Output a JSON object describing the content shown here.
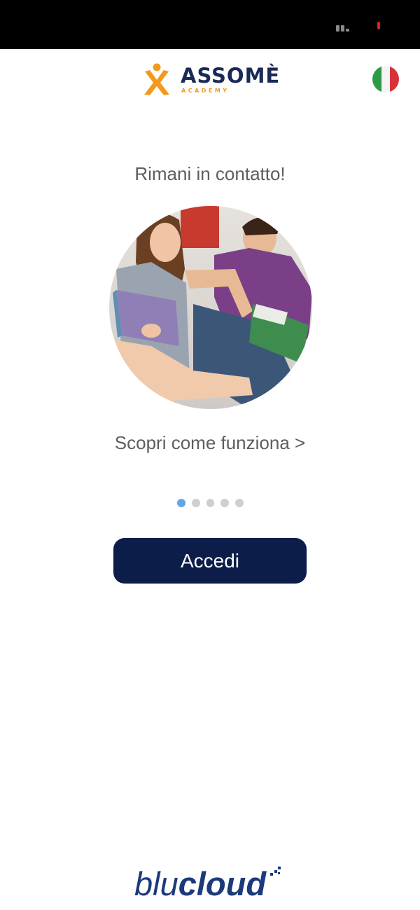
{
  "header": {
    "logo_name": "ASSOMÈ",
    "logo_tagline": "ACADEMY",
    "language_flag": "italian-flag-icon"
  },
  "carousel": {
    "title": "Rimani in contatto!",
    "link_label": "Scopri come funziona >",
    "page_count": 5,
    "active_page": 1
  },
  "actions": {
    "login_label": "Accedi"
  },
  "footer": {
    "brand_light": "blu",
    "brand_bold": "cloud"
  },
  "colors": {
    "primary_navy": "#0b1d48",
    "logo_orange": "#f29a1c",
    "dot_active": "#62a7e5",
    "dot_inactive": "#cfcfcf",
    "brand_blue": "#1b3a7d"
  }
}
